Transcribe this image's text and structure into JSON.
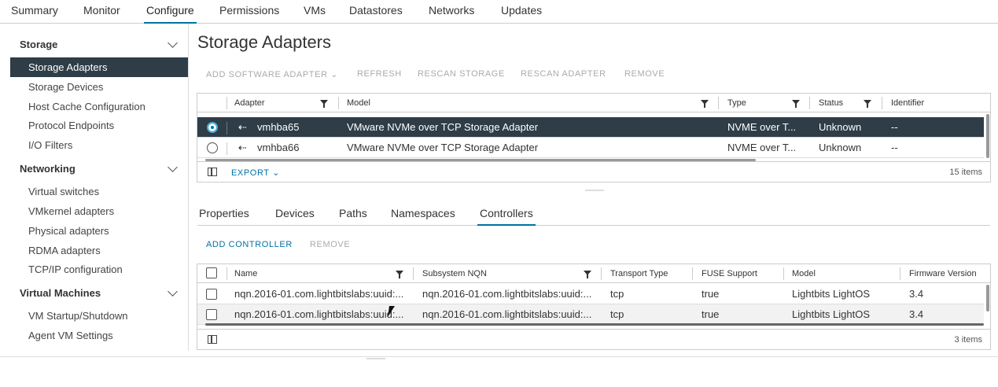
{
  "top_tabs": [
    {
      "label": "Summary"
    },
    {
      "label": "Monitor"
    },
    {
      "label": "Configure"
    },
    {
      "label": "Permissions"
    },
    {
      "label": "VMs"
    },
    {
      "label": "Datastores"
    },
    {
      "label": "Networks"
    },
    {
      "label": "Updates"
    }
  ],
  "sidebar": {
    "sections": [
      {
        "title": "Storage",
        "items": [
          "Storage Adapters",
          "Storage Devices",
          "Host Cache Configuration",
          "Protocol Endpoints",
          "I/O Filters"
        ]
      },
      {
        "title": "Networking",
        "items": [
          "Virtual switches",
          "VMkernel adapters",
          "Physical adapters",
          "RDMA adapters",
          "TCP/IP configuration"
        ]
      },
      {
        "title": "Virtual Machines",
        "items": [
          "VM Startup/Shutdown",
          "Agent VM Settings"
        ]
      }
    ],
    "selected": "Storage Adapters"
  },
  "page": {
    "title": "Storage Adapters"
  },
  "toolbar": {
    "add_software_adapter": "ADD SOFTWARE ADAPTER",
    "refresh": "REFRESH",
    "rescan_storage": "RESCAN STORAGE",
    "rescan_adapter": "RESCAN ADAPTER",
    "remove": "REMOVE"
  },
  "adapters_grid": {
    "columns": [
      "Adapter",
      "Model",
      "Type",
      "Status",
      "Identifier"
    ],
    "rows": [
      {
        "adapter": "vmhba65",
        "model": "VMware NVMe over TCP Storage Adapter",
        "type": "NVME over T...",
        "status": "Unknown",
        "identifier": "--",
        "selected": true
      },
      {
        "adapter": "vmhba66",
        "model": "VMware NVMe over TCP Storage Adapter",
        "type": "NVME over T...",
        "status": "Unknown",
        "identifier": "--",
        "selected": false
      }
    ],
    "export_label": "EXPORT",
    "count": "15 items"
  },
  "sub_tabs": [
    {
      "label": "Properties"
    },
    {
      "label": "Devices"
    },
    {
      "label": "Paths"
    },
    {
      "label": "Namespaces"
    },
    {
      "label": "Controllers"
    }
  ],
  "active_sub_tab": "Controllers",
  "controllers_toolbar": {
    "add_controller": "ADD CONTROLLER",
    "remove": "REMOVE"
  },
  "controllers_grid": {
    "columns": [
      "Name",
      "Subsystem NQN",
      "Transport Type",
      "FUSE Support",
      "Model",
      "Firmware Version"
    ],
    "rows": [
      {
        "name": "nqn.2016-01.com.lightbitslabs:uuid:...",
        "nqn": "nqn.2016-01.com.lightbitslabs:uuid:...",
        "transport": "tcp",
        "fuse": "true",
        "model": "Lightbits LightOS",
        "firmware": "3.4"
      },
      {
        "name": "nqn.2016-01.com.lightbitslabs:uuid:...",
        "nqn": "nqn.2016-01.com.lightbitslabs:uuid:...",
        "transport": "tcp",
        "fuse": "true",
        "model": "Lightbits LightOS",
        "firmware": "3.4"
      }
    ],
    "count": "3 items"
  },
  "colors": {
    "accent": "#0072a3",
    "selected_row": "#2e3d47"
  }
}
